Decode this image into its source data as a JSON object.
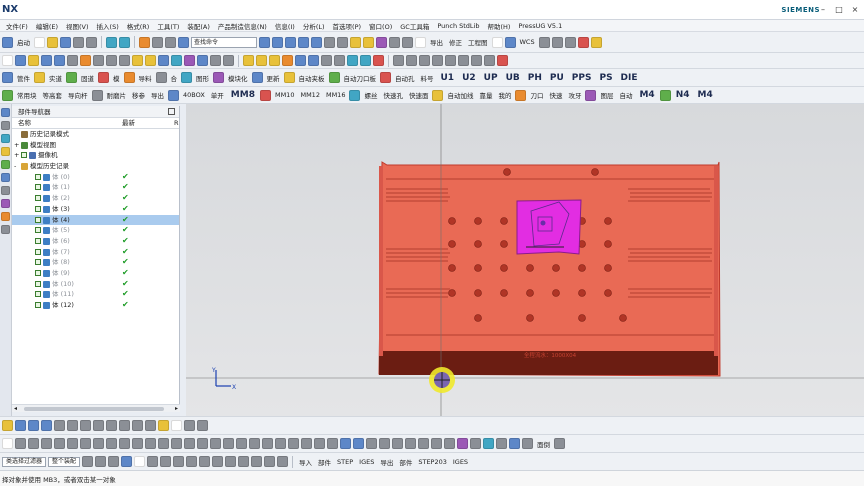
{
  "app": {
    "logo": "NX",
    "brand": "SIEMENS"
  },
  "menu": [
    "文件(F)",
    "编辑(E)",
    "视图(V)",
    "插入(S)",
    "格式(R)",
    "工具(T)",
    "装配(A)",
    "产品制造信息(N)",
    "信息(I)",
    "分析(L)",
    "首选项(P)",
    "窗口(O)",
    "GC工具箱",
    "Punch StdLib",
    "帮助(H)",
    "PressUG V5.1"
  ],
  "toolbar1": {
    "start_label": "启动",
    "command_search_placeholder": "查找命令",
    "import": "导出",
    "repair": "修正",
    "project": "工程图",
    "wcs": "WCS"
  },
  "toolbar2": {
    "feature_labels": [
      "料号",
      "U1",
      "U2",
      "UP",
      "UB",
      "PH",
      "PU",
      "PPS",
      "PS",
      "DIE"
    ],
    "tools_labels": [
      "管件",
      "实道",
      "固道",
      "模",
      "导料",
      "合",
      "图形",
      "模块化",
      "更新",
      "自动夹板",
      "自动刀口板",
      "自动孔"
    ]
  },
  "toolbar3": {
    "labels": [
      "常用块",
      "等高套",
      "导向杆",
      "耐磨片",
      "移参",
      "导出",
      "40BOX",
      "单开",
      "MM8",
      "MM10",
      "MM12",
      "MM16",
      "螺丝",
      "快速孔",
      "快速面",
      "自动加线",
      "靠量",
      "我的",
      "刀口",
      "快速",
      "攻牙",
      "图层",
      "自动",
      "M4",
      "N4",
      "M4"
    ]
  },
  "navigator": {
    "title": "部件导航器",
    "col_name": "名称",
    "col_latest": "最新",
    "col_extra": "R",
    "nodes": [
      {
        "label": "历史记录模式",
        "level": 1,
        "expand": "",
        "kind": "history",
        "checked": false,
        "tick": false,
        "selected": false,
        "dim": false
      },
      {
        "label": "模型视图",
        "level": 1,
        "expand": "+",
        "kind": "view",
        "checked": false,
        "tick": false,
        "selected": false,
        "dim": false
      },
      {
        "label": "摄像机",
        "level": 1,
        "expand": "+",
        "kind": "camera",
        "checked": true,
        "tick": false,
        "selected": false,
        "dim": false
      },
      {
        "label": "模型历史记录",
        "level": 1,
        "expand": "-",
        "kind": "folder",
        "checked": false,
        "tick": false,
        "selected": false,
        "dim": false
      },
      {
        "label": "体 (0)",
        "level": 2,
        "expand": "",
        "kind": "body",
        "checked": true,
        "tick": true,
        "selected": false,
        "dim": true
      },
      {
        "label": "体 (1)",
        "level": 2,
        "expand": "",
        "kind": "body",
        "checked": true,
        "tick": true,
        "selected": false,
        "dim": true
      },
      {
        "label": "体 (2)",
        "level": 2,
        "expand": "",
        "kind": "body",
        "checked": true,
        "tick": true,
        "selected": false,
        "dim": true
      },
      {
        "label": "体 (3)",
        "level": 2,
        "expand": "",
        "kind": "body",
        "checked": true,
        "tick": true,
        "selected": false,
        "dim": false
      },
      {
        "label": "体 (4)",
        "level": 2,
        "expand": "",
        "kind": "body",
        "checked": true,
        "tick": true,
        "selected": true,
        "dim": false
      },
      {
        "label": "体 (5)",
        "level": 2,
        "expand": "",
        "kind": "body",
        "checked": true,
        "tick": true,
        "selected": false,
        "dim": true
      },
      {
        "label": "体 (6)",
        "level": 2,
        "expand": "",
        "kind": "body",
        "checked": true,
        "tick": true,
        "selected": false,
        "dim": true
      },
      {
        "label": "体 (7)",
        "level": 2,
        "expand": "",
        "kind": "body",
        "checked": true,
        "tick": true,
        "selected": false,
        "dim": true
      },
      {
        "label": "体 (8)",
        "level": 2,
        "expand": "",
        "kind": "body",
        "checked": true,
        "tick": true,
        "selected": false,
        "dim": true
      },
      {
        "label": "体 (9)",
        "level": 2,
        "expand": "",
        "kind": "body",
        "checked": true,
        "tick": true,
        "selected": false,
        "dim": true
      },
      {
        "label": "体 (10)",
        "level": 2,
        "expand": "",
        "kind": "body",
        "checked": true,
        "tick": true,
        "selected": false,
        "dim": true
      },
      {
        "label": "体 (11)",
        "level": 2,
        "expand": "",
        "kind": "body",
        "checked": true,
        "tick": true,
        "selected": false,
        "dim": true
      },
      {
        "label": "体 (12)",
        "level": 2,
        "expand": "",
        "kind": "body",
        "checked": true,
        "tick": true,
        "selected": false,
        "dim": false
      }
    ]
  },
  "viewport": {
    "plate_color": "#e96a55",
    "plate_border": "#c0392b",
    "dark_band_color": "#6b1d12",
    "insert_color": "#e22de2",
    "plate_caption": "全程流水：1000X04",
    "axis_x": "X",
    "axis_y": "Y"
  },
  "bottom_toolbar": {
    "filter_label": "类选择过滤器",
    "scope_label": "整个装配",
    "fillet": "面倒",
    "import": "导入",
    "import_target": "部件",
    "step": "STEP",
    "iges": "IGES",
    "export": "导出",
    "export_target": "部件",
    "step203": "STEP203",
    "iges2": "IGES"
  },
  "status": {
    "message": "择对象并使用 MB3，或者双击某一对象"
  }
}
